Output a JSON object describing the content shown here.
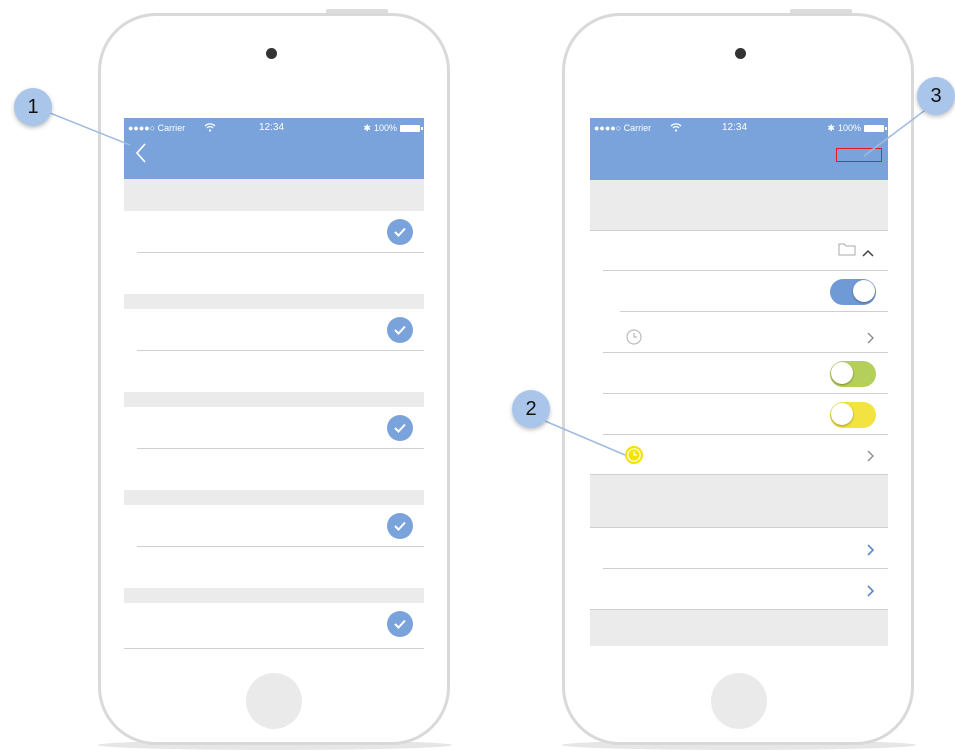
{
  "status_bar": {
    "carrier": "●●●●○ Carrier",
    "time": "12:34",
    "battery": "100%"
  },
  "left_screen": {
    "nav": {
      "back_icon": "chevron-left-icon"
    },
    "checked_rows": 5
  },
  "right_screen": {
    "nav": {
      "action_placeholder": "red-outline-box"
    },
    "toggles": [
      {
        "state": "on",
        "color": "#6f9ad6"
      },
      {
        "state": "off",
        "color": "#b5cf5b"
      },
      {
        "state": "off",
        "color": "#f2e341"
      }
    ]
  },
  "callouts": {
    "one": "1",
    "two": "2",
    "three": "3"
  },
  "colors": {
    "nav": "#7aa3dc",
    "check": "#7aa3dc",
    "callout": "#a9c6ea",
    "band": "#ebebeb",
    "highlight_icon": "#f2e300",
    "annotation_box": "#e01e1e"
  }
}
